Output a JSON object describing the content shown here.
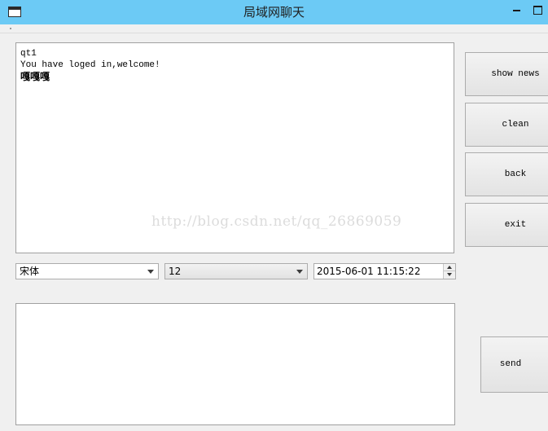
{
  "window": {
    "title": "局域网聊天",
    "controls": [
      "minimize",
      "maximize"
    ]
  },
  "chat": {
    "messages": [
      "qt1",
      "You have loged in,welcome!",
      "嘎嘎嘎"
    ],
    "watermark": "http://blog.csdn.net/qq_26869059"
  },
  "toolbar": {
    "font_family": "宋体",
    "font_size": "12",
    "datetime": "2015-06-01 11:15:22"
  },
  "input": {
    "value": ""
  },
  "buttons": {
    "show_news": "show news",
    "clean": "clean",
    "back": "back",
    "exit": "exit",
    "send": "send"
  },
  "icons": {
    "app": "app-window-icon",
    "minimize": "minimize-icon",
    "maximize": "maximize-icon",
    "dropdown": "chevron-down-icon",
    "spin_up": "spin-up-icon",
    "spin_down": "spin-down-icon"
  }
}
